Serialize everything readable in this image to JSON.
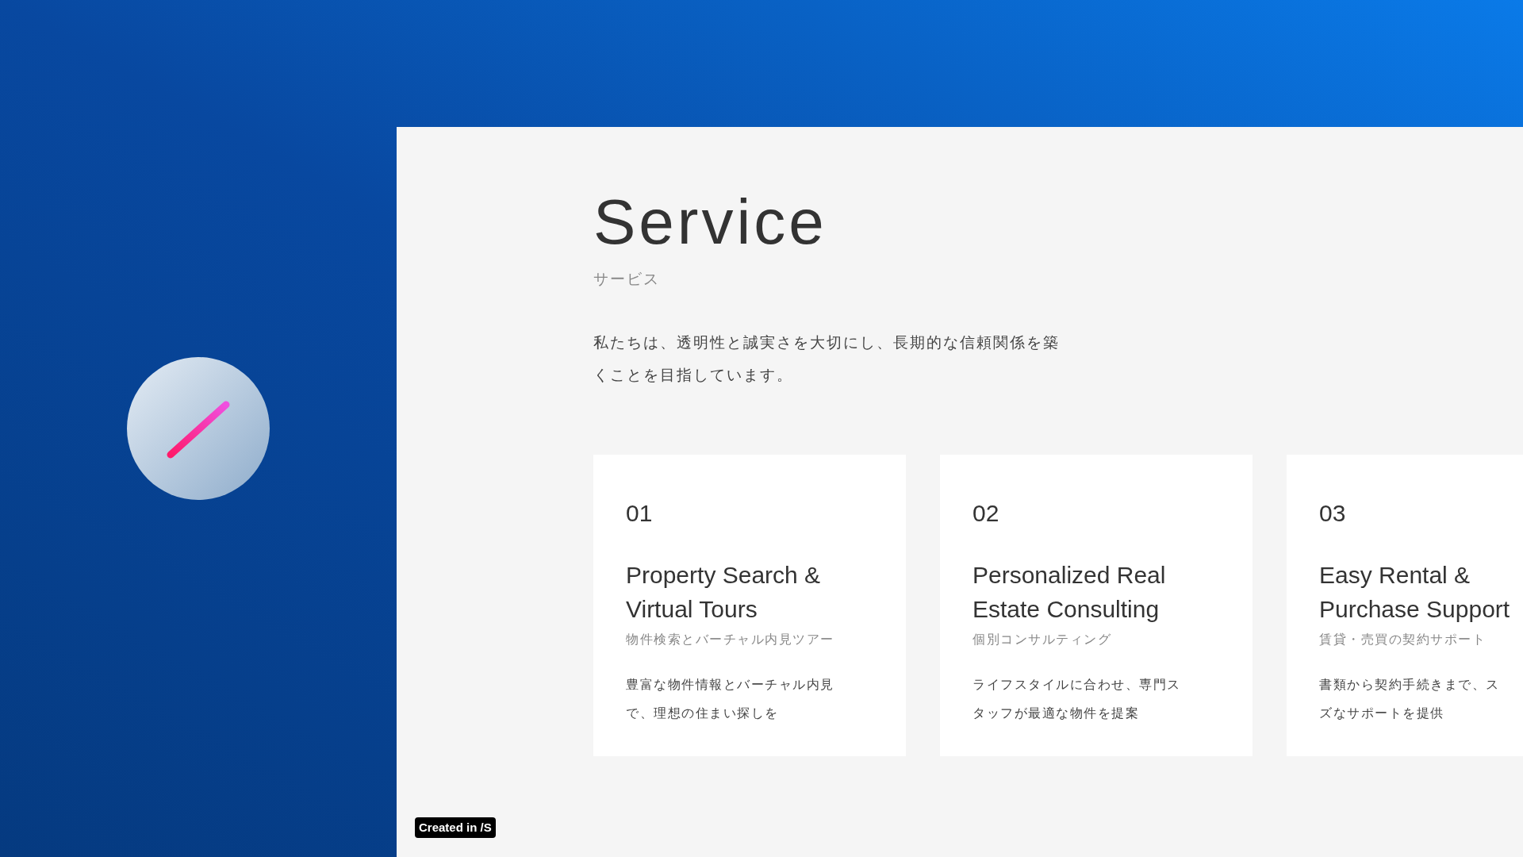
{
  "section": {
    "title": "Service",
    "subtitle": "サービス",
    "lead": [
      "私たちは、透明性と誠実さを大切にし、長期的な信頼関係を築",
      "くことを目指しています。"
    ]
  },
  "cards": [
    {
      "number": "01",
      "title": "Property Search & Virtual Tours",
      "subtitle": "物件検索とバーチャル内見ツアー",
      "text": [
        "豊富な物件情報とバーチャル内見",
        "で、理想の住まい探しを"
      ]
    },
    {
      "number": "02",
      "title": "Personalized Real Estate Consulting",
      "subtitle": "個別コンサルティング",
      "text": [
        "ライフスタイルに合わせ、専門ス",
        "タッフが最適な物件を提案"
      ]
    },
    {
      "number": "03",
      "title": "Easy Rental & Purchase Support",
      "subtitle": "賃貸・売買の契約サポート",
      "text": [
        "書類から契約手続きまで、ス",
        "ズなサポートを提供"
      ]
    }
  ],
  "badge": {
    "label": "Created in /S"
  }
}
